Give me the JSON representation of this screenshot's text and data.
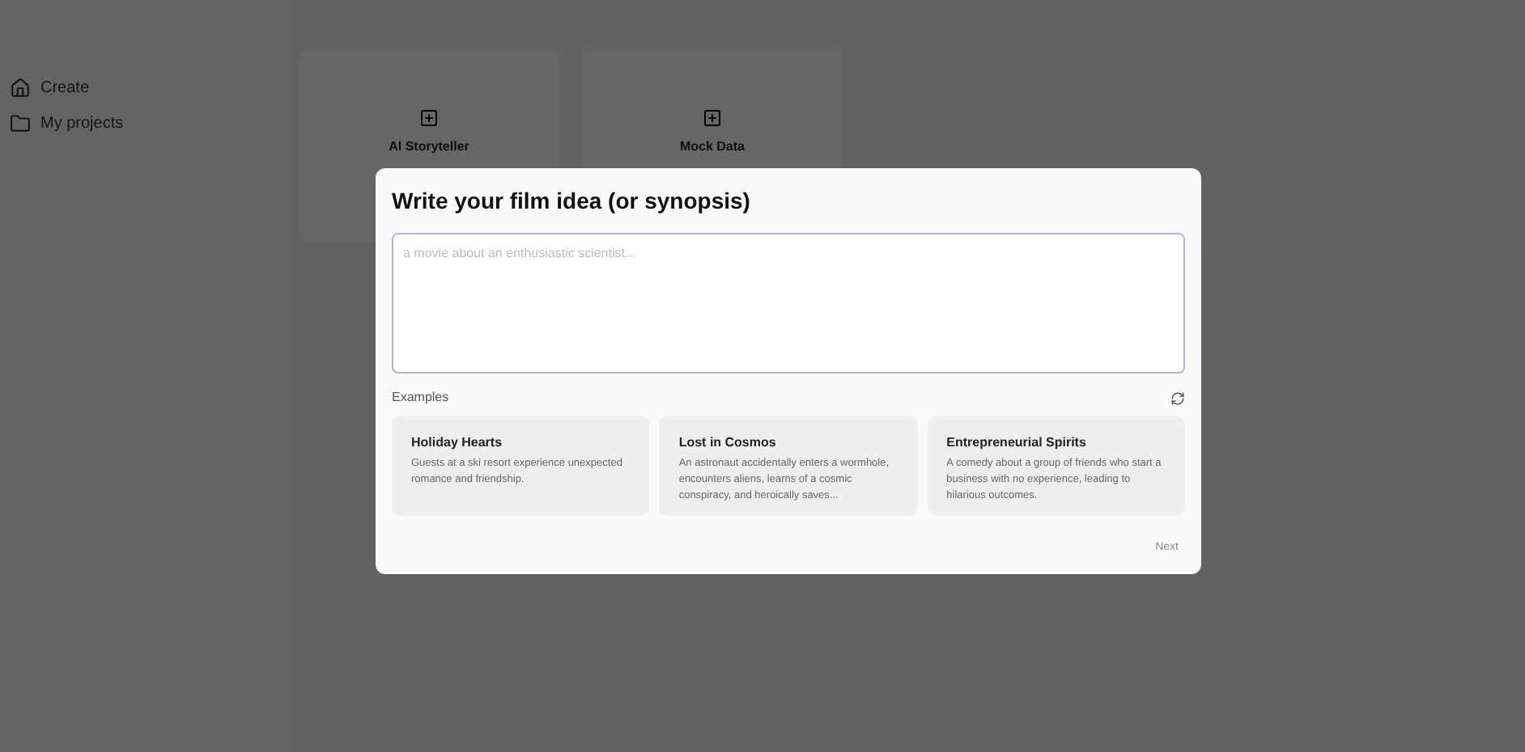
{
  "sidebar": {
    "items": [
      {
        "label": "Create"
      },
      {
        "label": "My projects"
      }
    ]
  },
  "cards": [
    {
      "title": "AI Storyteller"
    },
    {
      "title": "Mock Data"
    }
  ],
  "dialog": {
    "title": "Write your film idea (or synopsis)",
    "input": {
      "placeholder": "a movie about an enthusiastic scientist..."
    },
    "examples_label": "Examples",
    "examples": [
      {
        "title": "Holiday Hearts",
        "text": "Guests at a ski resort experience unexpected romance and friendship."
      },
      {
        "title": "Lost in Cosmos",
        "text": "An astronaut accidentally enters a wormhole, encounters aliens, learns of a cosmic conspiracy, and heroically saves..."
      },
      {
        "title": "Entrepreneurial Spirits",
        "text": "A comedy about a group of friends who start a business with no experience, leading to hilarious outcomes."
      }
    ],
    "next_button": {
      "label": "Next",
      "disabled": true
    }
  }
}
